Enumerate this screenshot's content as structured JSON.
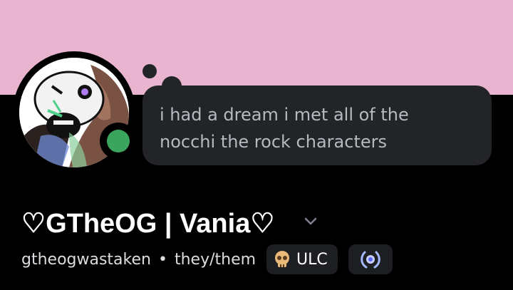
{
  "status_bubble": {
    "line1": "i had a dream i met all of the",
    "line2": "nocchi the rock characters"
  },
  "profile": {
    "display_name": "♡GTheOG | Vania♡",
    "username": "gtheogwastaken",
    "separator": "•",
    "pronouns": "they/them",
    "server_tag": {
      "label": "ULC",
      "icon": "skull-icon"
    },
    "badge_icon": "wreath-badge-icon",
    "status": "online"
  },
  "colors": {
    "banner": "#e8b4d0",
    "background": "#000000",
    "bubble": "#232428",
    "status_online": "#3ba55d",
    "badge_bg": "#1e1f22",
    "badge_accent": "#a6b8ff"
  }
}
